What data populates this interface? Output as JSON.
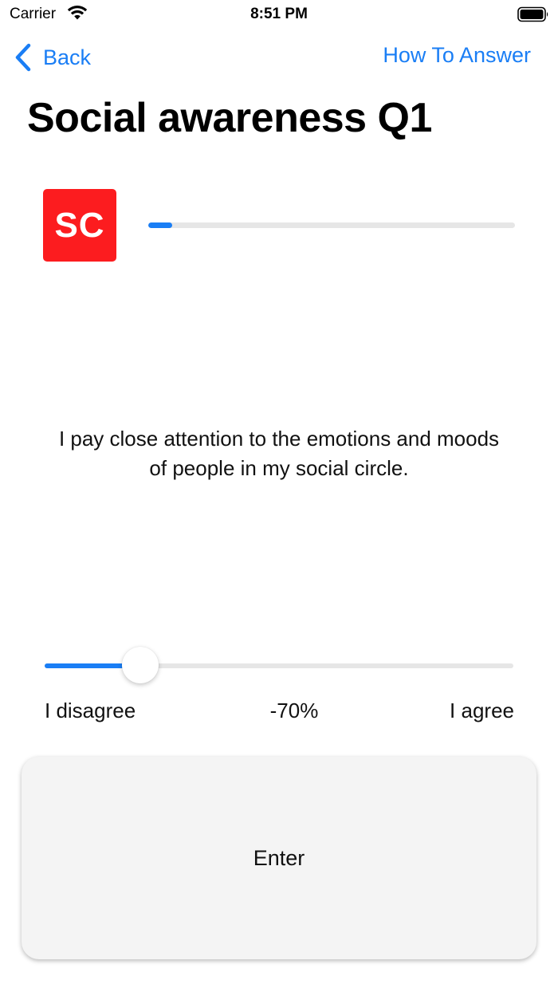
{
  "status_bar": {
    "carrier": "Carrier",
    "time": "8:51 PM",
    "wifi_icon": "wifi-icon",
    "battery_icon": "battery-icon"
  },
  "nav": {
    "back_label": "Back",
    "back_icon": "chevron-left-icon",
    "help_label": "How To Answer"
  },
  "title": "Social awareness Q1",
  "category": {
    "badge_text": "SC",
    "badge_color": "#fc1c1f"
  },
  "progress": {
    "value_fraction": 0.065
  },
  "question": {
    "text": "I pay close attention to the emotions and moods of people in my social circle."
  },
  "slider": {
    "min_label": "I disagree",
    "max_label": "I agree",
    "value_label": "-70%",
    "value_percent": -70,
    "min": -100,
    "max": 100
  },
  "enter_button": {
    "label": "Enter"
  },
  "colors": {
    "accent": "#1a7ef5",
    "track": "#e6e6e6",
    "button_bg": "#f4f4f4"
  }
}
